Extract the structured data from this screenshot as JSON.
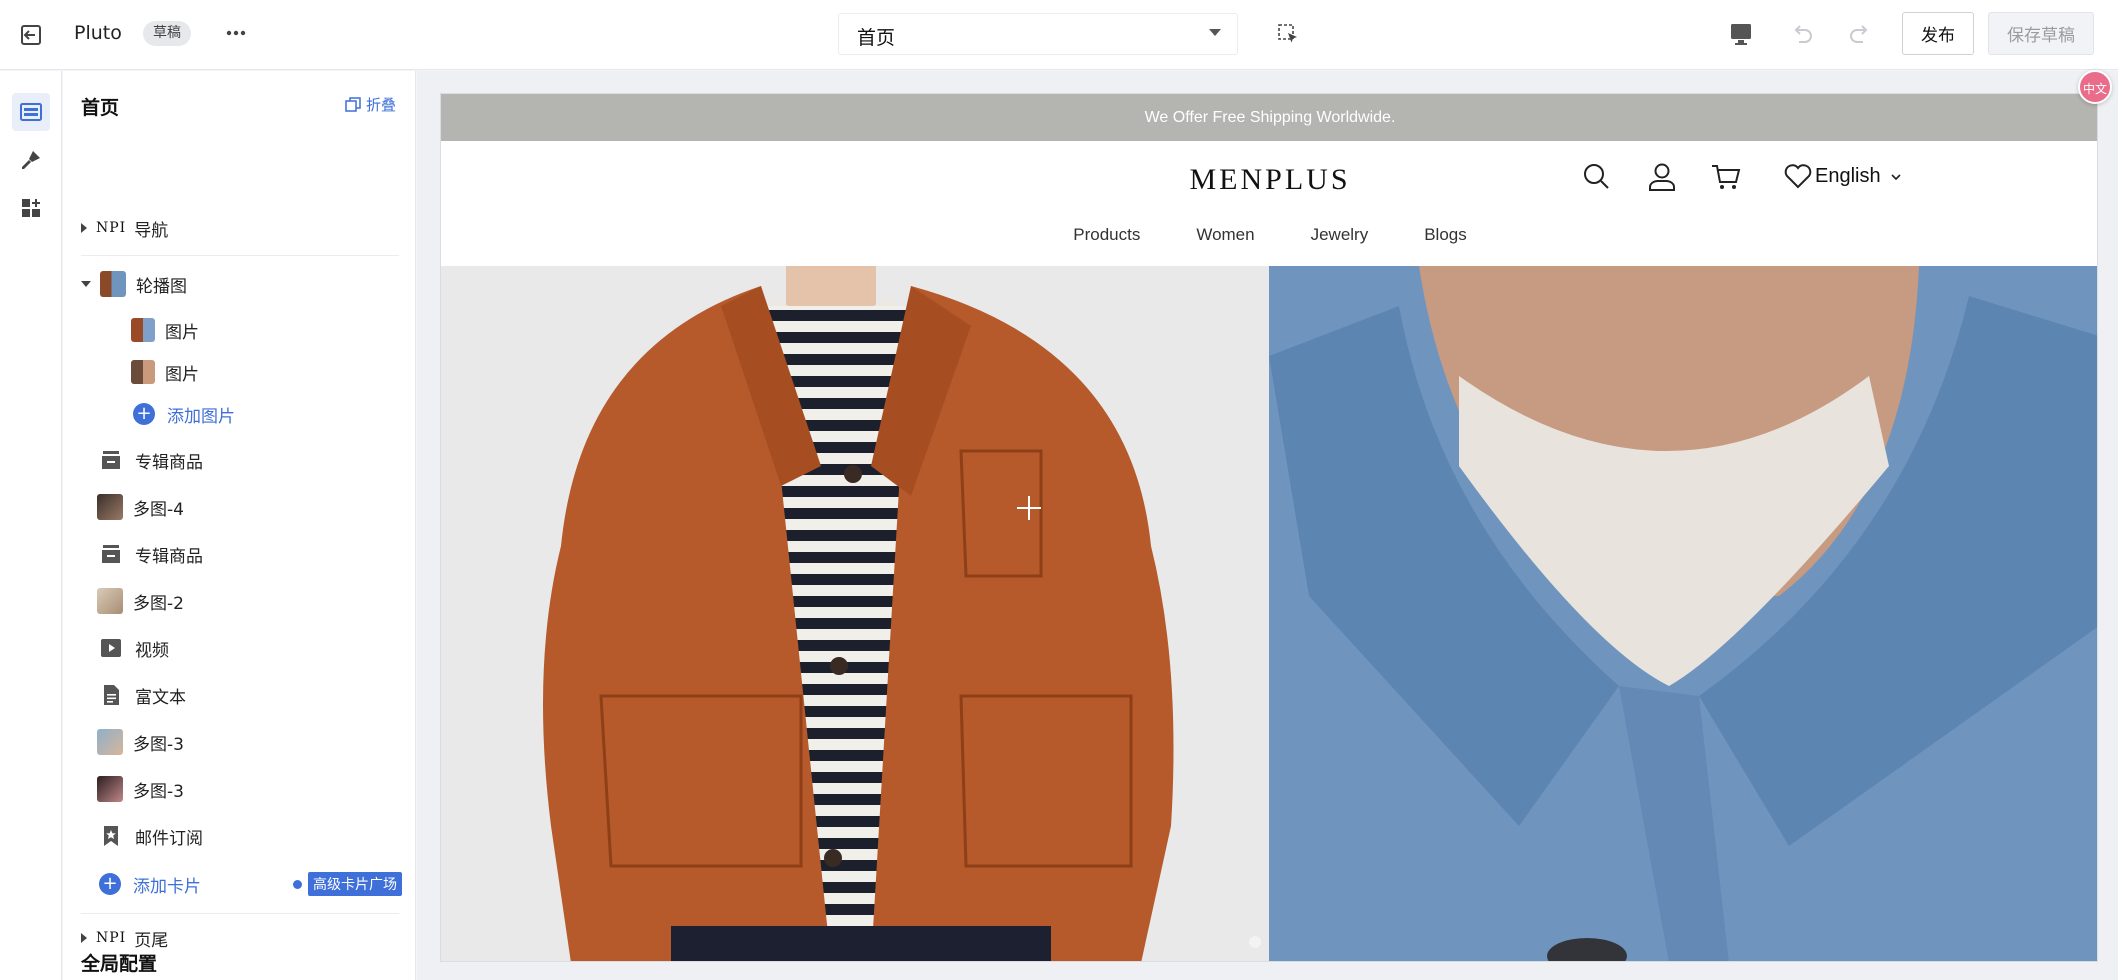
{
  "topbar": {
    "app_name": "Pluto",
    "status_badge": "草稿",
    "page_select": "首页",
    "publish_label": "发布",
    "save_draft_label": "保存草稿"
  },
  "panel": {
    "title": "首页",
    "collapse_label": "折叠",
    "nav": {
      "prefix": "NPI",
      "label": "导航"
    },
    "carousel": {
      "label": "轮播图",
      "children": [
        "图片",
        "图片"
      ],
      "add_image": "添加图片"
    },
    "cards": [
      {
        "label": "专辑商品",
        "icon": "collection-icon"
      },
      {
        "label": "多图-4",
        "icon": "thumbnail"
      },
      {
        "label": "专辑商品",
        "icon": "collection-icon"
      },
      {
        "label": "多图-2",
        "icon": "thumbnail"
      },
      {
        "label": "视频",
        "icon": "video-icon"
      },
      {
        "label": "富文本",
        "icon": "document-icon"
      },
      {
        "label": "多图-3",
        "icon": "thumbnail"
      },
      {
        "label": "多图-3",
        "icon": "thumbnail"
      },
      {
        "label": "邮件订阅",
        "icon": "bookmark-star-icon"
      }
    ],
    "add_card": "添加卡片",
    "advanced_badge": "高级卡片广场",
    "footer": {
      "prefix": "NPI",
      "label": "页尾"
    },
    "global_config": "全局配置"
  },
  "preview": {
    "announcement": "We Offer Free Shipping Worldwide.",
    "logo": "MENPLUS",
    "language": "English",
    "nav_links": [
      "Products",
      "Women",
      "Jewelry",
      "Blogs"
    ]
  },
  "colors": {
    "accent": "#3f6fd8",
    "announcement_bg": "#b4b4b0",
    "jacket_orange": "#b85a2a",
    "denim_blue": "#6f95bf"
  },
  "floating": {
    "translate_label": "中文"
  }
}
